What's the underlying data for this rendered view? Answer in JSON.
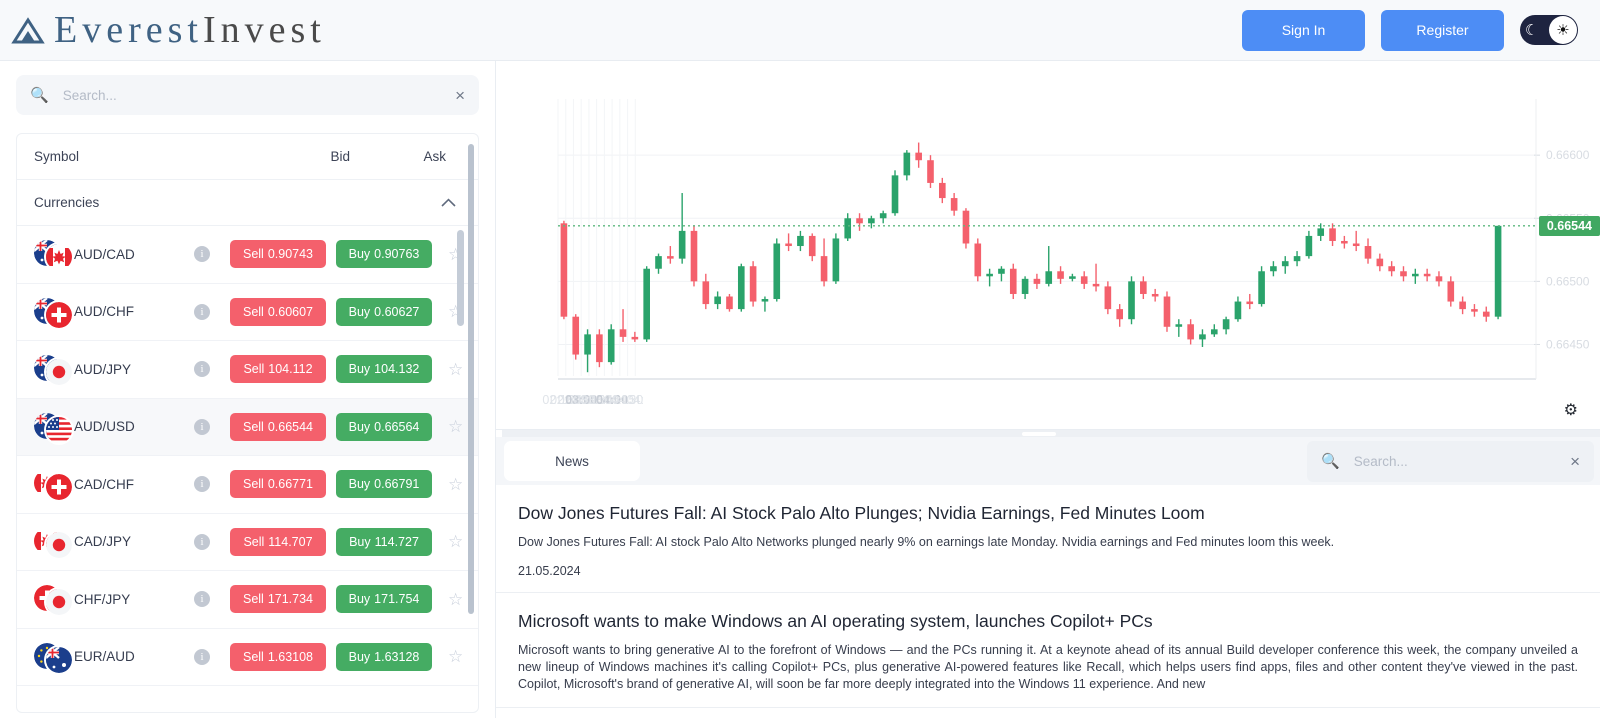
{
  "header": {
    "brand_primary": "Everest",
    "brand_secondary": "Invest",
    "sign_in_label": "Sign In",
    "register_label": "Register",
    "moon_icon": "moon-icon",
    "sun_icon": "sun-icon",
    "accent_color": "#4d8df5"
  },
  "sidebar": {
    "search": {
      "value": "",
      "placeholder": "Search...",
      "clear_label": "×"
    },
    "columns": {
      "symbol": "Symbol",
      "bid": "Bid",
      "ask": "Ask"
    },
    "group": {
      "label": "Currencies",
      "expanded": true
    },
    "sell_label": "Sell",
    "buy_label": "Buy",
    "info_char": "i",
    "star_char": "☆",
    "rows": [
      {
        "symbol": "AUD/CAD",
        "bid": "0.90743",
        "ask": "0.90763",
        "selected": false,
        "flag_a": "au",
        "flag_b": "ca"
      },
      {
        "symbol": "AUD/CHF",
        "bid": "0.60607",
        "ask": "0.60627",
        "selected": false,
        "flag_a": "au",
        "flag_b": "ch"
      },
      {
        "symbol": "AUD/JPY",
        "bid": "104.112",
        "ask": "104.132",
        "selected": false,
        "flag_a": "au",
        "flag_b": "jp"
      },
      {
        "symbol": "AUD/USD",
        "bid": "0.66544",
        "ask": "0.66564",
        "selected": true,
        "flag_a": "au",
        "flag_b": "us"
      },
      {
        "symbol": "CAD/CHF",
        "bid": "0.66771",
        "ask": "0.66791",
        "selected": false,
        "flag_a": "ca",
        "flag_b": "ch"
      },
      {
        "symbol": "CAD/JPY",
        "bid": "114.707",
        "ask": "114.727",
        "selected": false,
        "flag_a": "ca",
        "flag_b": "jp"
      },
      {
        "symbol": "CHF/JPY",
        "bid": "171.734",
        "ask": "171.754",
        "selected": false,
        "flag_a": "ch",
        "flag_b": "jp"
      },
      {
        "symbol": "EUR/AUD",
        "bid": "1.63108",
        "ask": "1.63128",
        "selected": false,
        "flag_a": "eu",
        "flag_b": "au"
      }
    ],
    "sell_color": "#f4606c",
    "buy_color": "#45ac63"
  },
  "chart_data": {
    "type": "candlestick",
    "title": "",
    "xlabel": "",
    "ylabel": "",
    "instrument": "AUD/USD",
    "current_price": "0.66544",
    "current_price_color": "#41a862",
    "grid": true,
    "ylim": [
      0.66425,
      0.66635
    ],
    "y_ticks": [
      "0.66600",
      "0.66550",
      "0.66500",
      "0.66450"
    ],
    "y_tick_values": [
      0.666,
      0.6655,
      0.665,
      0.6645
    ],
    "x_ticks": [
      "02:15",
      "02:30",
      "02:45",
      "03:00",
      "03:15",
      "03:30",
      "03:45",
      "04:00",
      "04:15",
      "04:30",
      "04:"
    ],
    "x_ticks_bold": [
      "03:00",
      "04:00"
    ],
    "up_color": "#2aa36b",
    "down_color": "#f4606c",
    "gear_icon": "gear-icon",
    "candles": [
      [
        0.66546,
        0.66548,
        0.6647,
        0.66472
      ],
      [
        0.66472,
        0.66474,
        0.66438,
        0.66442
      ],
      [
        0.66442,
        0.66462,
        0.66428,
        0.66458
      ],
      [
        0.66458,
        0.66462,
        0.66432,
        0.66436
      ],
      [
        0.66436,
        0.66466,
        0.66434,
        0.66462
      ],
      [
        0.66462,
        0.66478,
        0.66452,
        0.66456
      ],
      [
        0.66456,
        0.6646,
        0.66452,
        0.66454
      ],
      [
        0.66454,
        0.66512,
        0.66452,
        0.6651
      ],
      [
        0.6651,
        0.66522,
        0.66506,
        0.6652
      ],
      [
        0.6652,
        0.66528,
        0.66514,
        0.66518
      ],
      [
        0.66518,
        0.6657,
        0.66514,
        0.6654
      ],
      [
        0.6654,
        0.66544,
        0.66496,
        0.665
      ],
      [
        0.665,
        0.66506,
        0.66478,
        0.66482
      ],
      [
        0.66482,
        0.66492,
        0.66478,
        0.66488
      ],
      [
        0.66488,
        0.6649,
        0.66476,
        0.66478
      ],
      [
        0.66478,
        0.66514,
        0.66476,
        0.66512
      ],
      [
        0.66512,
        0.66516,
        0.6648,
        0.66484
      ],
      [
        0.66484,
        0.66488,
        0.66476,
        0.66486
      ],
      [
        0.66486,
        0.66534,
        0.66484,
        0.6653
      ],
      [
        0.6653,
        0.66538,
        0.66524,
        0.66528
      ],
      [
        0.66528,
        0.6654,
        0.66524,
        0.66536
      ],
      [
        0.66536,
        0.66538,
        0.66516,
        0.6652
      ],
      [
        0.6652,
        0.66534,
        0.66496,
        0.665
      ],
      [
        0.665,
        0.66538,
        0.66498,
        0.66534
      ],
      [
        0.66534,
        0.66554,
        0.66532,
        0.6655
      ],
      [
        0.6655,
        0.66554,
        0.6654,
        0.66546
      ],
      [
        0.66546,
        0.66552,
        0.66542,
        0.6655
      ],
      [
        0.6655,
        0.66556,
        0.66546,
        0.66554
      ],
      [
        0.66554,
        0.66588,
        0.66552,
        0.66584
      ],
      [
        0.66584,
        0.66604,
        0.6658,
        0.66602
      ],
      [
        0.66602,
        0.6661,
        0.6659,
        0.66596
      ],
      [
        0.66596,
        0.666,
        0.66574,
        0.66578
      ],
      [
        0.66578,
        0.66582,
        0.66562,
        0.66566
      ],
      [
        0.66566,
        0.6657,
        0.66552,
        0.66556
      ],
      [
        0.66556,
        0.66558,
        0.66526,
        0.6653
      ],
      [
        0.6653,
        0.66534,
        0.665,
        0.66504
      ],
      [
        0.66504,
        0.6651,
        0.66496,
        0.66506
      ],
      [
        0.66506,
        0.66512,
        0.665,
        0.6651
      ],
      [
        0.6651,
        0.66514,
        0.66486,
        0.6649
      ],
      [
        0.6649,
        0.66504,
        0.66486,
        0.66502
      ],
      [
        0.66502,
        0.66506,
        0.66494,
        0.66498
      ],
      [
        0.66498,
        0.66528,
        0.66496,
        0.66508
      ],
      [
        0.66508,
        0.66512,
        0.66498,
        0.66502
      ],
      [
        0.66502,
        0.66506,
        0.665,
        0.66504
      ],
      [
        0.66504,
        0.66508,
        0.66494,
        0.66498
      ],
      [
        0.66498,
        0.66514,
        0.66492,
        0.66496
      ],
      [
        0.66496,
        0.665,
        0.66474,
        0.66478
      ],
      [
        0.66478,
        0.66482,
        0.66464,
        0.6647
      ],
      [
        0.6647,
        0.66504,
        0.66466,
        0.665
      ],
      [
        0.665,
        0.66504,
        0.66486,
        0.6649
      ],
      [
        0.6649,
        0.66494,
        0.66484,
        0.66488
      ],
      [
        0.66488,
        0.66492,
        0.6646,
        0.66464
      ],
      [
        0.66464,
        0.6647,
        0.66456,
        0.66466
      ],
      [
        0.66466,
        0.6647,
        0.6645,
        0.66454
      ],
      [
        0.66454,
        0.66462,
        0.66448,
        0.66458
      ],
      [
        0.66458,
        0.66466,
        0.66456,
        0.66462
      ],
      [
        0.66462,
        0.66472,
        0.66458,
        0.6647
      ],
      [
        0.6647,
        0.66488,
        0.66468,
        0.66484
      ],
      [
        0.66484,
        0.6649,
        0.66478,
        0.66482
      ],
      [
        0.66482,
        0.66512,
        0.6648,
        0.66508
      ],
      [
        0.66508,
        0.66516,
        0.66504,
        0.66512
      ],
      [
        0.66512,
        0.6652,
        0.66506,
        0.66516
      ],
      [
        0.66516,
        0.66524,
        0.66512,
        0.6652
      ],
      [
        0.6652,
        0.6654,
        0.66518,
        0.66536
      ],
      [
        0.66536,
        0.66546,
        0.66532,
        0.66542
      ],
      [
        0.66542,
        0.66546,
        0.66528,
        0.66532
      ],
      [
        0.66532,
        0.66536,
        0.66526,
        0.6653
      ],
      [
        0.6653,
        0.6654,
        0.66524,
        0.66528
      ],
      [
        0.66528,
        0.66534,
        0.66514,
        0.66518
      ],
      [
        0.66518,
        0.66522,
        0.66508,
        0.66512
      ],
      [
        0.66512,
        0.66516,
        0.66504,
        0.66508
      ],
      [
        0.66508,
        0.66512,
        0.665,
        0.66504
      ],
      [
        0.66504,
        0.6651,
        0.66498,
        0.66506
      ],
      [
        0.66506,
        0.6651,
        0.665,
        0.66504
      ],
      [
        0.66504,
        0.66508,
        0.66496,
        0.665
      ],
      [
        0.665,
        0.66504,
        0.6648,
        0.66484
      ],
      [
        0.66484,
        0.66488,
        0.66474,
        0.66478
      ],
      [
        0.66478,
        0.66482,
        0.66472,
        0.66476
      ],
      [
        0.66476,
        0.6648,
        0.66468,
        0.66472
      ],
      [
        0.66472,
        0.66544,
        0.6647,
        0.66544
      ]
    ]
  },
  "news": {
    "drag_handle": "resize-handle",
    "tab_label": "News",
    "search": {
      "value": "",
      "placeholder": "Search...",
      "clear_label": "×"
    },
    "items": [
      {
        "title": "Dow Jones Futures Fall: AI Stock Palo Alto Plunges; Nvidia Earnings, Fed Minutes Loom",
        "description": "Dow Jones Futures Fall: AI stock Palo Alto Networks plunged nearly 9% on earnings late Monday. Nvidia earnings and Fed minutes loom this week.",
        "date": "21.05.2024"
      },
      {
        "title": "Microsoft wants to make Windows an AI operating system, launches Copilot+ PCs",
        "description": "Microsoft wants to bring generative AI to the forefront of Windows — and the PCs running it. At a keynote ahead of its annual Build developer conference this week, the company unveiled a new lineup of Windows machines it's calling Copilot+ PCs, plus generative AI-powered features like Recall, which helps users find apps, files and other content they've viewed in the past. Copilot, Microsoft's brand of generative AI, will soon be far more deeply integrated into the Windows 11 experience. And new",
        "date": ""
      }
    ]
  }
}
